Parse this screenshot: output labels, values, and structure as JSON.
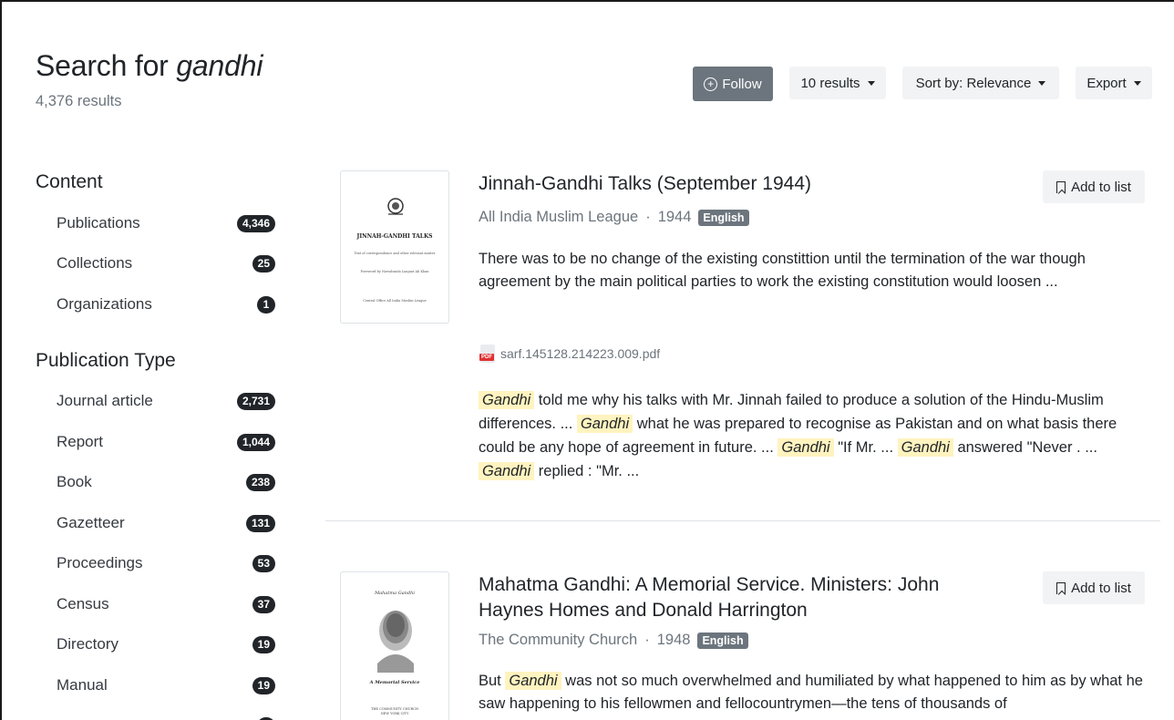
{
  "header": {
    "title_prefix": "Search for ",
    "query": "gandhi",
    "result_count": "4,376 results",
    "follow_label": "Follow",
    "per_page_label": "10 results",
    "sort_label": "Sort by: Relevance",
    "export_label": "Export"
  },
  "facets": {
    "content": {
      "heading": "Content",
      "items": [
        {
          "label": "Publications",
          "count": "4,346"
        },
        {
          "label": "Collections",
          "count": "25"
        },
        {
          "label": "Organizations",
          "count": "1"
        }
      ]
    },
    "publication_type": {
      "heading": "Publication Type",
      "items": [
        {
          "label": "Journal article",
          "count": "2,731"
        },
        {
          "label": "Report",
          "count": "1,044"
        },
        {
          "label": "Book",
          "count": "238"
        },
        {
          "label": "Gazetteer",
          "count": "131"
        },
        {
          "label": "Proceedings",
          "count": "53"
        },
        {
          "label": "Census",
          "count": "37"
        },
        {
          "label": "Directory",
          "count": "19"
        },
        {
          "label": "Manual",
          "count": "19"
        }
      ]
    }
  },
  "results": [
    {
      "title": "Jinnah-Gandhi Talks (September 1944)",
      "author": "All India Muslim League",
      "year": "1944",
      "language": "English",
      "add_label": "Add to list",
      "abstract": "There was to be no change of the existing constittion until the termination of the war though agreement by the main political parties to work the existing constitution would loosen ...",
      "file_name": "sarf.145128.214223.009.pdf",
      "file_icon": "pdf-icon",
      "highlight": {
        "h1": "Gandhi",
        "t1": " told me why his talks with Mr. Jinnah failed to produce a solution of the Hindu-Muslim differences.  ... ",
        "h2": "Gandhi",
        "t2": " what he was prepared to recognise as Pakistan and on what basis there could be any hope of agreement in future.  ... ",
        "h3": "Gandhi",
        "t3": " \"If Mr.  ... ",
        "h4": "Gandhi",
        "t4": " answered \"Never .  ... ",
        "h5": "Gandhi",
        "t5": " replied : \"Mr.  ..."
      },
      "thumb": {
        "title": "JINNAH-GANDHI TALKS",
        "subtitle": "Text of correspondence and other relevant matter",
        "foreword": "Foreword by Nawabzada Liaquat Ali Khan",
        "publisher": "Central Office All India Muslim League"
      }
    },
    {
      "title": "Mahatma Gandhi: A Memorial Service. Ministers: John Haynes Homes and Donald Harrington",
      "author": "The Community Church",
      "year": "1948",
      "language": "English",
      "add_label": "Add to list",
      "abstract_pre": "But ",
      "abstract_hl": "Gandhi",
      "abstract_post": " was not so much overwhelmed and humiliated by what happened to him as by what he saw happening to his fellowmen and fellocountrymen—the tens of thousands of",
      "thumb": {
        "title": "Mahatma Gandhi",
        "subtitle": "A Memorial Service",
        "publisher": "THE COMMUNITY CHURCH NEW YORK CITY"
      }
    }
  ],
  "colors": {
    "badge_dark": "#212529",
    "follow_bg": "#6c757d",
    "highlight": "#fff3bf",
    "muted": "#6c757d"
  }
}
